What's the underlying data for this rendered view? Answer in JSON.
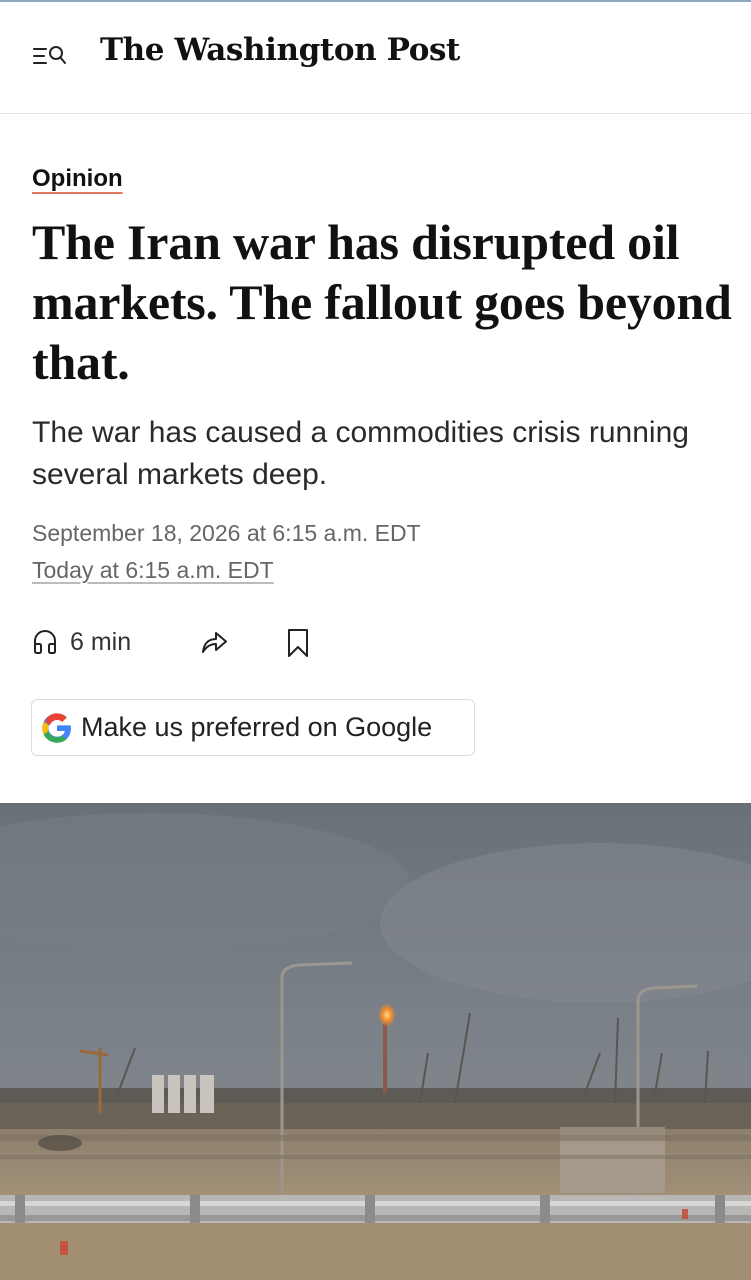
{
  "header": {
    "menu_search_icon": "menu-search-icon",
    "masthead": "The Washington Post"
  },
  "article": {
    "kicker": "Opinion",
    "headline": "The Iran war has disrupted oil markets. The fallout goes beyond that.",
    "dek": "The war has caused a commodities crisis running several markets deep.",
    "published": "September 18, 2026 at 6:15 a.m. EDT",
    "updated": "Today at 6:15 a.m. EDT"
  },
  "actions": {
    "listen_icon": "headphones-icon",
    "listen_label": "6 min",
    "share_icon": "share-icon",
    "save_icon": "bookmark-icon"
  },
  "google_cta": {
    "icon": "google-g-icon",
    "label": "Make us preferred on Google"
  },
  "photo": {
    "description_icon": "lead-photo-industrial-site"
  },
  "colors": {
    "kicker_underline": "#e07a5f",
    "date_text": "#666666",
    "top_line": "#8fa6c2"
  }
}
